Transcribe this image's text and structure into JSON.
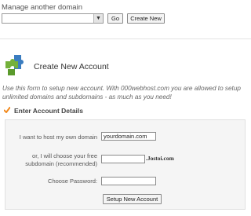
{
  "manage": {
    "label": "Manage another domain",
    "select_value": "",
    "go_label": "Go",
    "create_new_label": "Create New"
  },
  "account": {
    "title": "Create New Account",
    "intro": "Use this form to setup new account. With 000webhost.com you are allowed to setup unlimited domains and subdomains - as much as you need!",
    "section_heading": "Enter Account Details"
  },
  "form": {
    "host_label": "I want to host my own domain",
    "host_value": "yourdomain.com",
    "subdomain_label": "or, I will choose your free subdomain (recommended)",
    "subdomain_value": "",
    "subdomain_suffix": ".Jostoi.com",
    "password_label": "Choose Password:",
    "password_value": "",
    "submit_label": "Setup New Account"
  },
  "colors": {
    "puzzle_green": "#74b13a",
    "puzzle_blue": "#3b7dc0",
    "check_orange": "#f28a1e",
    "panel_bg": "#f5f5f5"
  }
}
